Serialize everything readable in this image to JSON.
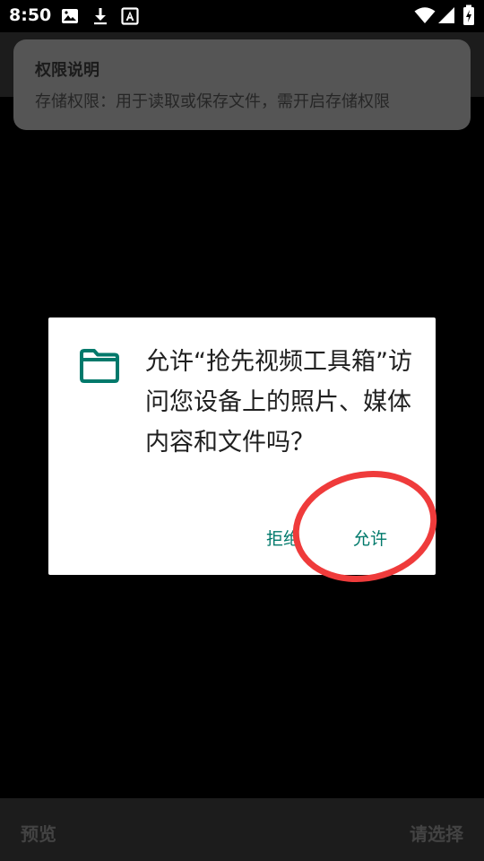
{
  "status_bar": {
    "time": "8:50",
    "icons": [
      "image-icon",
      "download-icon",
      "a-icon",
      "wifi-icon",
      "signal-icon",
      "battery-icon"
    ]
  },
  "notice": {
    "title": "权限说明",
    "description": "存储权限：用于读取或保存文件，需开启存储权限"
  },
  "dialog": {
    "icon": "folder-icon",
    "message": "允许“抢先视频工具箱”访问您设备上的照片、媒体内容和文件吗？",
    "deny_label": "拒绝",
    "allow_label": "允许",
    "accent_color": "#00796b"
  },
  "annotation": {
    "color": "#ef3b3b"
  },
  "bottom_bar": {
    "left_label": "预览",
    "right_label": "请选择"
  }
}
